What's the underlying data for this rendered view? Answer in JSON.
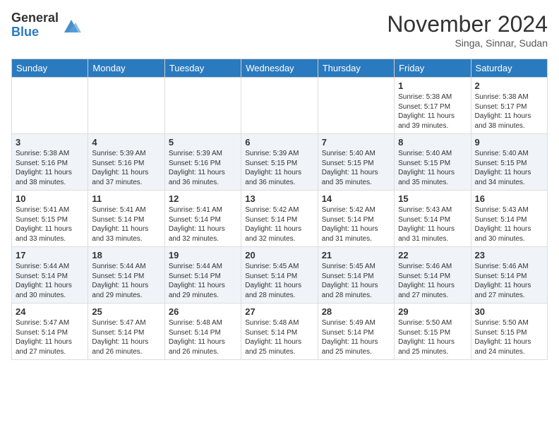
{
  "logo": {
    "general": "General",
    "blue": "Blue"
  },
  "title": "November 2024",
  "location": "Singa, Sinnar, Sudan",
  "days_of_week": [
    "Sunday",
    "Monday",
    "Tuesday",
    "Wednesday",
    "Thursday",
    "Friday",
    "Saturday"
  ],
  "weeks": [
    [
      {
        "day": "",
        "content": ""
      },
      {
        "day": "",
        "content": ""
      },
      {
        "day": "",
        "content": ""
      },
      {
        "day": "",
        "content": ""
      },
      {
        "day": "",
        "content": ""
      },
      {
        "day": "1",
        "content": "Sunrise: 5:38 AM\nSunset: 5:17 PM\nDaylight: 11 hours\nand 39 minutes."
      },
      {
        "day": "2",
        "content": "Sunrise: 5:38 AM\nSunset: 5:17 PM\nDaylight: 11 hours\nand 38 minutes."
      }
    ],
    [
      {
        "day": "3",
        "content": "Sunrise: 5:38 AM\nSunset: 5:16 PM\nDaylight: 11 hours\nand 38 minutes."
      },
      {
        "day": "4",
        "content": "Sunrise: 5:39 AM\nSunset: 5:16 PM\nDaylight: 11 hours\nand 37 minutes."
      },
      {
        "day": "5",
        "content": "Sunrise: 5:39 AM\nSunset: 5:16 PM\nDaylight: 11 hours\nand 36 minutes."
      },
      {
        "day": "6",
        "content": "Sunrise: 5:39 AM\nSunset: 5:15 PM\nDaylight: 11 hours\nand 36 minutes."
      },
      {
        "day": "7",
        "content": "Sunrise: 5:40 AM\nSunset: 5:15 PM\nDaylight: 11 hours\nand 35 minutes."
      },
      {
        "day": "8",
        "content": "Sunrise: 5:40 AM\nSunset: 5:15 PM\nDaylight: 11 hours\nand 35 minutes."
      },
      {
        "day": "9",
        "content": "Sunrise: 5:40 AM\nSunset: 5:15 PM\nDaylight: 11 hours\nand 34 minutes."
      }
    ],
    [
      {
        "day": "10",
        "content": "Sunrise: 5:41 AM\nSunset: 5:15 PM\nDaylight: 11 hours\nand 33 minutes."
      },
      {
        "day": "11",
        "content": "Sunrise: 5:41 AM\nSunset: 5:14 PM\nDaylight: 11 hours\nand 33 minutes."
      },
      {
        "day": "12",
        "content": "Sunrise: 5:41 AM\nSunset: 5:14 PM\nDaylight: 11 hours\nand 32 minutes."
      },
      {
        "day": "13",
        "content": "Sunrise: 5:42 AM\nSunset: 5:14 PM\nDaylight: 11 hours\nand 32 minutes."
      },
      {
        "day": "14",
        "content": "Sunrise: 5:42 AM\nSunset: 5:14 PM\nDaylight: 11 hours\nand 31 minutes."
      },
      {
        "day": "15",
        "content": "Sunrise: 5:43 AM\nSunset: 5:14 PM\nDaylight: 11 hours\nand 31 minutes."
      },
      {
        "day": "16",
        "content": "Sunrise: 5:43 AM\nSunset: 5:14 PM\nDaylight: 11 hours\nand 30 minutes."
      }
    ],
    [
      {
        "day": "17",
        "content": "Sunrise: 5:44 AM\nSunset: 5:14 PM\nDaylight: 11 hours\nand 30 minutes."
      },
      {
        "day": "18",
        "content": "Sunrise: 5:44 AM\nSunset: 5:14 PM\nDaylight: 11 hours\nand 29 minutes."
      },
      {
        "day": "19",
        "content": "Sunrise: 5:44 AM\nSunset: 5:14 PM\nDaylight: 11 hours\nand 29 minutes."
      },
      {
        "day": "20",
        "content": "Sunrise: 5:45 AM\nSunset: 5:14 PM\nDaylight: 11 hours\nand 28 minutes."
      },
      {
        "day": "21",
        "content": "Sunrise: 5:45 AM\nSunset: 5:14 PM\nDaylight: 11 hours\nand 28 minutes."
      },
      {
        "day": "22",
        "content": "Sunrise: 5:46 AM\nSunset: 5:14 PM\nDaylight: 11 hours\nand 27 minutes."
      },
      {
        "day": "23",
        "content": "Sunrise: 5:46 AM\nSunset: 5:14 PM\nDaylight: 11 hours\nand 27 minutes."
      }
    ],
    [
      {
        "day": "24",
        "content": "Sunrise: 5:47 AM\nSunset: 5:14 PM\nDaylight: 11 hours\nand 27 minutes."
      },
      {
        "day": "25",
        "content": "Sunrise: 5:47 AM\nSunset: 5:14 PM\nDaylight: 11 hours\nand 26 minutes."
      },
      {
        "day": "26",
        "content": "Sunrise: 5:48 AM\nSunset: 5:14 PM\nDaylight: 11 hours\nand 26 minutes."
      },
      {
        "day": "27",
        "content": "Sunrise: 5:48 AM\nSunset: 5:14 PM\nDaylight: 11 hours\nand 25 minutes."
      },
      {
        "day": "28",
        "content": "Sunrise: 5:49 AM\nSunset: 5:14 PM\nDaylight: 11 hours\nand 25 minutes."
      },
      {
        "day": "29",
        "content": "Sunrise: 5:50 AM\nSunset: 5:15 PM\nDaylight: 11 hours\nand 25 minutes."
      },
      {
        "day": "30",
        "content": "Sunrise: 5:50 AM\nSunset: 5:15 PM\nDaylight: 11 hours\nand 24 minutes."
      }
    ]
  ]
}
